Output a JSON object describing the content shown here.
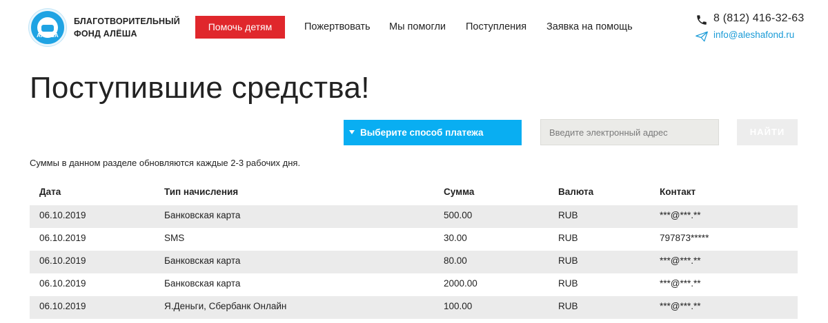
{
  "header": {
    "logo_text": "АЛЁША",
    "brand_line1": "БЛАГОТВОРИТЕЛЬНЫЙ",
    "brand_line2": "ФОНД АЛЁША",
    "help_button": "Помочь детям",
    "nav": [
      "Пожертвовать",
      "Мы помогли",
      "Поступления",
      "Заявка на помощь"
    ],
    "phone": "8 (812) 416-32-63",
    "email": "info@aleshafond.ru"
  },
  "page": {
    "title": "Поступившие средства!",
    "payment_select": "Выберите способ платежа",
    "email_placeholder": "Введите электронный адрес",
    "find_button": "НАЙТИ",
    "note": "Суммы в данном разделе обновляются каждые 2-3 рабочих дня."
  },
  "table": {
    "columns": [
      "Дата",
      "Тип начисления",
      "Сумма",
      "Валюта",
      "Контакт"
    ],
    "rows": [
      [
        "06.10.2019",
        "Банковская карта",
        "500.00",
        "RUB",
        "***@***.**"
      ],
      [
        "06.10.2019",
        "SMS",
        "30.00",
        "RUB",
        "797873*****"
      ],
      [
        "06.10.2019",
        "Банковская карта",
        "80.00",
        "RUB",
        "***@***.**"
      ],
      [
        "06.10.2019",
        "Банковская карта",
        "2000.00",
        "RUB",
        "***@***.**"
      ],
      [
        "06.10.2019",
        "Я.Деньги, Сбербанк Онлайн",
        "100.00",
        "RUB",
        "***@***.**"
      ]
    ]
  },
  "colors": {
    "accent_red": "#e0272c",
    "accent_blue": "#09aef2",
    "link_blue": "#1a9bd7",
    "row_alt": "#ebebeb"
  },
  "icons": {
    "phone": "phone-icon",
    "mail": "paper-plane-icon",
    "caret": "caret-down-icon"
  }
}
